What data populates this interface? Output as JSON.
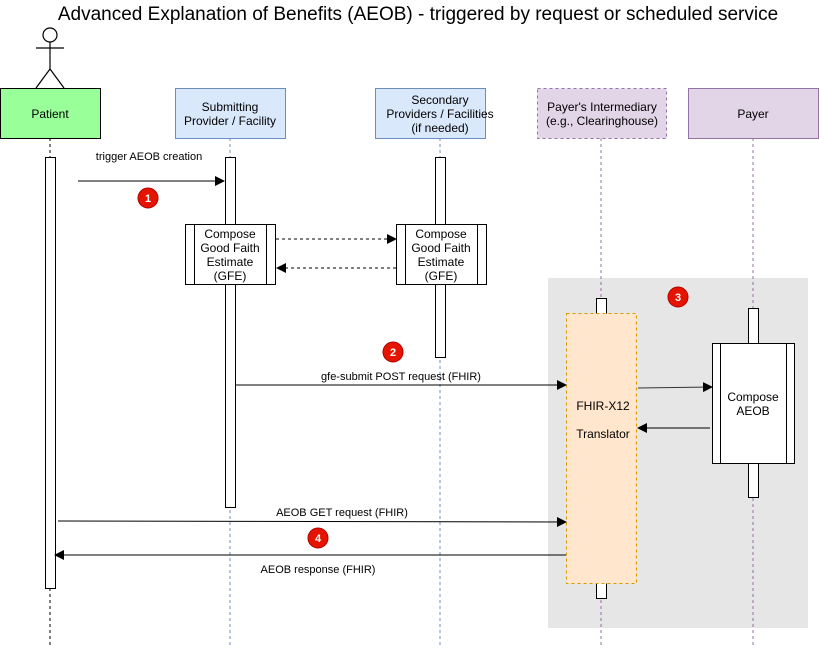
{
  "title": "Advanced Explanation of Benefits (AEOB) - triggered by request or scheduled service",
  "participants": {
    "patient": {
      "label": "Patient",
      "fill": "#99ff99",
      "stroke": "#000000"
    },
    "submitting": {
      "line1": "Submitting",
      "line2": "Provider / Facility",
      "fill": "#dae8fc",
      "stroke": "#6c8ebf"
    },
    "secondary": {
      "line1": "Secondary",
      "line2": "Providers / Facilities",
      "line3": "(if needed)",
      "fill": "#dae8fc",
      "stroke": "#6c8ebf"
    },
    "intermediary": {
      "line1": "Payer's Intermediary",
      "line2": "(e.g., Clearinghouse)",
      "fill": "#e1d5e7",
      "stroke": "#9673a6"
    },
    "payer": {
      "label": "Payer",
      "fill": "#e1d5e7",
      "stroke": "#9673a6"
    }
  },
  "processes": {
    "gfe_submitting": {
      "line1": "Compose",
      "line2": "Good Faith",
      "line3": "Estimate",
      "line4": "(GFE)"
    },
    "gfe_secondary": {
      "line1": "Compose",
      "line2": "Good Faith",
      "line3": "Estimate",
      "line4": "(GFE)"
    },
    "translator": {
      "line1": "FHIR-X12",
      "line2": "Translator",
      "fill": "#ffe6cc",
      "stroke": "#d79b00"
    },
    "compose_aeob": {
      "line1": "Compose",
      "line2": "AEOB"
    }
  },
  "messages": {
    "trigger": "trigger AEOB creation",
    "gfe_submit": "gfe-submit POST request (FHIR)",
    "aeob_get": "AEOB GET request (FHIR)",
    "aeob_response": "AEOB response (FHIR)"
  },
  "badges": {
    "b1": "1",
    "b2": "2",
    "b3": "3",
    "b4": "4",
    "color": "#e51400"
  },
  "group_fill": "#e6e6e6"
}
